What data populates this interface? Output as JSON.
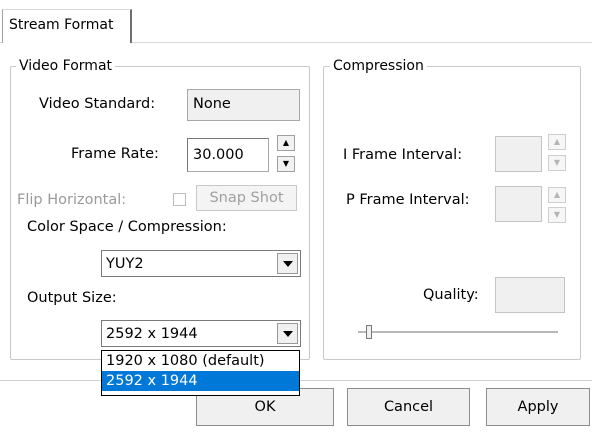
{
  "tab": {
    "label": "Stream Format"
  },
  "video_format": {
    "legend": "Video Format",
    "video_standard": {
      "label": "Video Standard:",
      "value": "None"
    },
    "frame_rate": {
      "label": "Frame Rate:",
      "value": "30.000"
    },
    "flip_horizontal": {
      "label": "Flip Horizontal:",
      "checked": false
    },
    "snap_shot": {
      "label": "Snap Shot"
    },
    "color_space": {
      "label": "Color Space / Compression:",
      "value": "YUY2"
    },
    "output_size": {
      "label": "Output Size:",
      "value": "2592 x 1944",
      "options": [
        "1920 x 1080  (default)",
        "2592 x 1944"
      ],
      "highlighted_index": 1
    }
  },
  "compression": {
    "legend": "Compression",
    "i_frame_interval": {
      "label": "I Frame Interval:",
      "value": ""
    },
    "p_frame_interval": {
      "label": "P Frame Interval:",
      "value": ""
    },
    "quality": {
      "label": "Quality:",
      "value": ""
    }
  },
  "footer": {
    "ok_label": "OK",
    "cancel_label": "Cancel",
    "apply_label": "Apply"
  },
  "colors": {
    "selection": "#0078d7",
    "disabled_text": "#9a9a9a"
  },
  "icons": [
    "spin-up-icon",
    "spin-down-icon",
    "dropdown-arrow-icon",
    "checkbox-icon"
  ]
}
